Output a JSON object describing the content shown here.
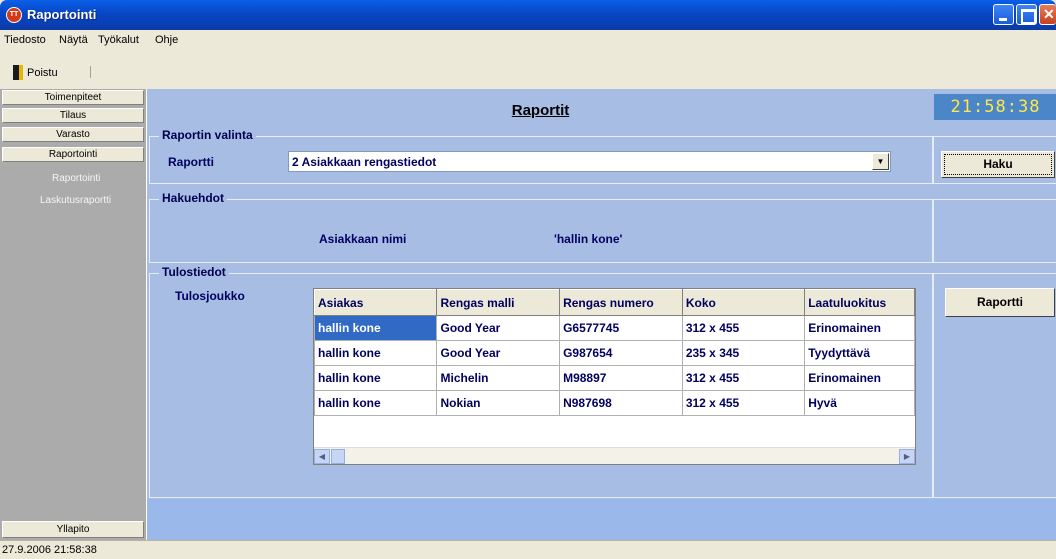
{
  "window": {
    "title": "Raportointi",
    "icon": "app-logo-icon"
  },
  "menu": [
    "Tiedosto",
    "Näytä",
    "Työkalut",
    "Ohje"
  ],
  "toolbar": {
    "exit_label": "Poistu",
    "exit_icon": "door-exit-icon"
  },
  "sidebar": {
    "buttons": [
      "Toimenpiteet",
      "Tilaus",
      "Varasto",
      "Raportointi"
    ],
    "links": [
      "Raportointi",
      "Laskutusraportti"
    ],
    "bottom_button": "Yllapito"
  },
  "header": {
    "title": "Raportit",
    "clock": "21:58:38"
  },
  "report_selection": {
    "legend": "Raportin valinta",
    "label": "Raportti",
    "selected": "2 Asiakkaan rengastiedot",
    "search_button": "Haku"
  },
  "criteria": {
    "legend": "Hakuehdot",
    "field_label": "Asiakkaan nimi",
    "field_value": "'hallin kone'"
  },
  "results": {
    "legend": "Tulostiedot",
    "label": "Tulosjoukko",
    "report_button": "Raportti",
    "columns": [
      "Asiakas",
      "Rengas malli",
      "Rengas numero",
      "Koko",
      "Laatuluokitus"
    ],
    "rows": [
      [
        "hallin kone",
        "Good Year",
        "G6577745",
        "312 x 455",
        "Erinomainen"
      ],
      [
        "hallin kone",
        "Good Year",
        "G987654",
        "235 x 345",
        "Tyydyttävä"
      ],
      [
        "hallin kone",
        "Michelin",
        "M98897",
        "312 x 455",
        "Erinomainen"
      ],
      [
        "hallin kone",
        "Nokian",
        "N987698",
        "312 x 455",
        "Hyvä"
      ]
    ]
  },
  "status": {
    "datetime": "27.9.2006 21:58:38"
  },
  "colors": {
    "panel": "#A8BDE4",
    "clock_bg": "#4A86C8",
    "clock_text": "#FFE84A",
    "selection": "#316AC5"
  }
}
